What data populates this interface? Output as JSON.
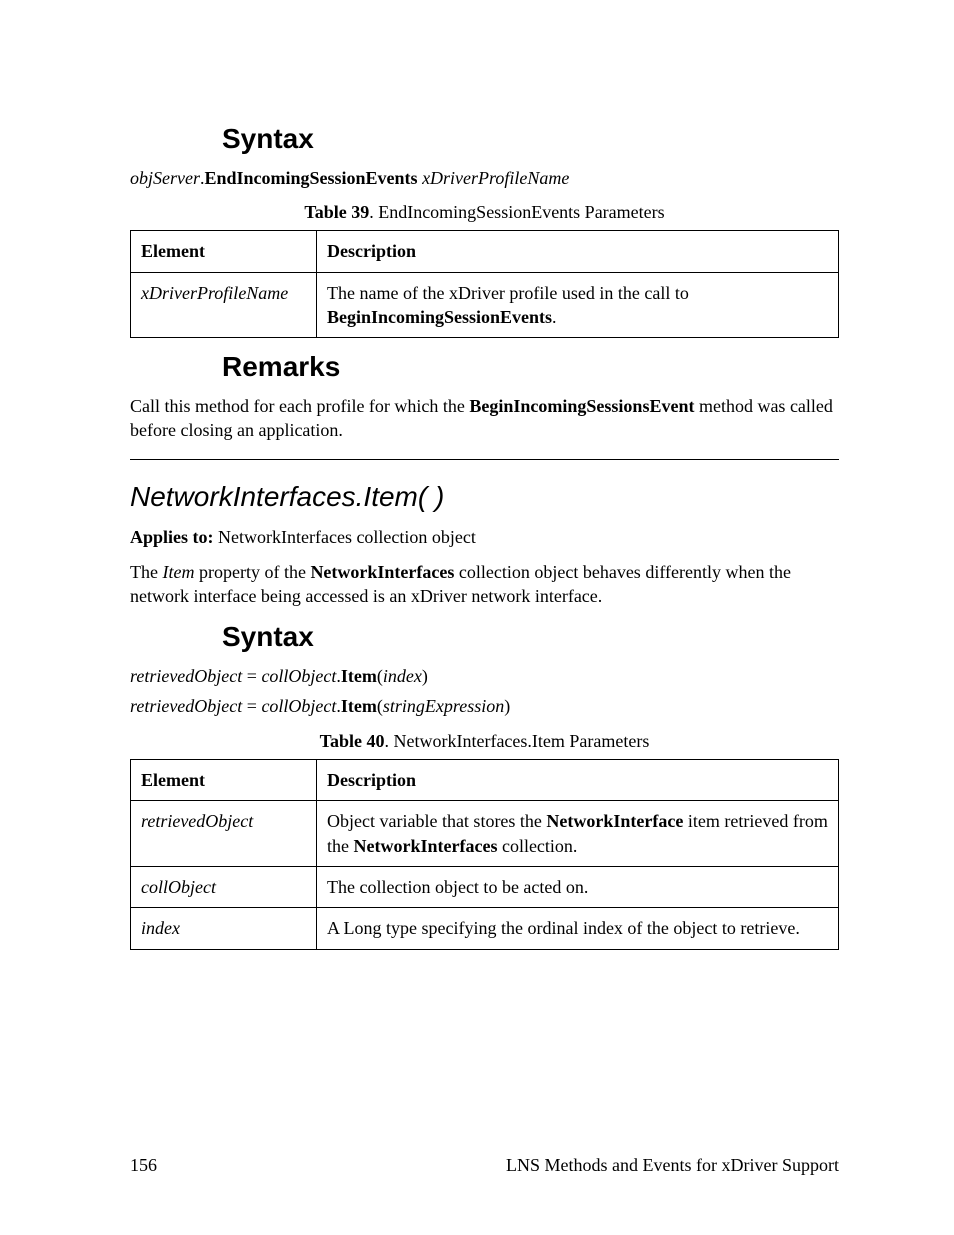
{
  "sec1": {
    "heading_syntax": "Syntax",
    "syntax_obj": "objServer",
    "syntax_dot": ".",
    "syntax_method": "EndIncomingSessionEvents",
    "syntax_sp": " ",
    "syntax_arg": "xDriverProfileName",
    "table_caption_b": "Table 39",
    "table_caption_rest": ". EndIncomingSessionEvents Parameters",
    "th_element": "Element",
    "th_desc": "Description",
    "row1_el": "xDriverProfileName",
    "row1_desc_a": "The name of the xDriver profile used in the call to ",
    "row1_desc_bold": "BeginIncomingSessionEvents",
    "row1_desc_b": ".",
    "heading_remarks": "Remarks",
    "remarks_a": "Call this method for each profile for which the ",
    "remarks_bold": "BeginIncomingSessionsEvent",
    "remarks_b": " method was called before closing an application."
  },
  "sec2": {
    "title": "NetworkInterfaces.Item( )",
    "applies_label": "Applies to:",
    "applies_val": "  NetworkInterfaces collection object",
    "intro_a": "The ",
    "intro_item": "Item",
    "intro_b": " property of the ",
    "intro_bold": "NetworkInterfaces",
    "intro_c": " collection object behaves differently when the network interface being accessed is an xDriver network interface.",
    "heading_syntax": "Syntax",
    "s1_a": "retrievedObject",
    "s1_eq": " = ",
    "s1_b": "collObject",
    "s1_dot": ".",
    "s1_item": "Item",
    "s1_lp": "(",
    "s1_arg": "index",
    "s1_rp": ")",
    "s2_a": "retrievedObject",
    "s2_eq": " = ",
    "s2_b": "collObject",
    "s2_dot": ".",
    "s2_item": "Item",
    "s2_lp": "(",
    "s2_arg": "stringExpression",
    "s2_rp": ")",
    "table_caption_b": "Table 40",
    "table_caption_rest": ". NetworkInterfaces.Item Parameters",
    "th_element": "Element",
    "th_desc": "Description",
    "r1_el": "retrievedObject",
    "r1_a": "Object variable that stores the ",
    "r1_b1": "NetworkInterface",
    "r1_b": " item retrieved from the ",
    "r1_b2": "NetworkInterfaces",
    "r1_c": " collection.",
    "r2_el": "collObject",
    "r2_desc": "The collection object to be acted on.",
    "r3_el": "index",
    "r3_desc": "A Long type specifying the ordinal index of the object to retrieve."
  },
  "footer": {
    "page": "156",
    "title": "LNS Methods and Events for xDriver Support"
  }
}
